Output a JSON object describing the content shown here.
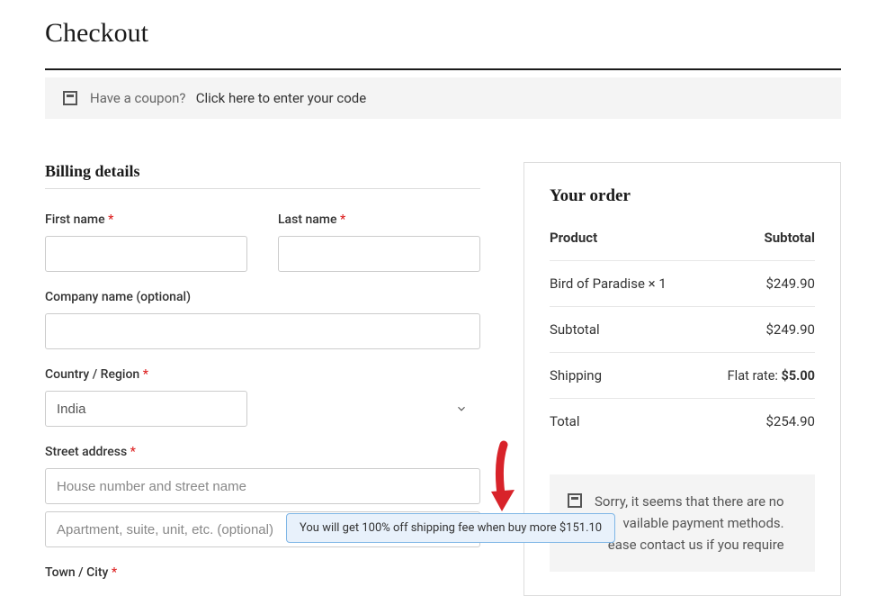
{
  "page_title": "Checkout",
  "coupon": {
    "prompt": "Have a coupon?",
    "link": "Click here to enter your code"
  },
  "billing": {
    "title": "Billing details",
    "first_name_label": "First name",
    "last_name_label": "Last name",
    "company_label": "Company name (optional)",
    "country_label": "Country / Region",
    "country_value": "India",
    "street_label": "Street address",
    "street_placeholder1": "House number and street name",
    "street_placeholder2": "Apartment, suite, unit, etc. (optional)",
    "town_label": "Town / City",
    "required": "*"
  },
  "order": {
    "title": "Your order",
    "head_product": "Product",
    "head_subtotal": "Subtotal",
    "item_name": "Bird of Paradise × 1",
    "item_price": "$249.90",
    "subtotal_label": "Subtotal",
    "subtotal_value": "$249.90",
    "shipping_label": "Shipping",
    "shipping_prefix": "Flat rate:",
    "shipping_amount": "$5.00",
    "total_label": "Total",
    "total_value": "$254.90"
  },
  "payment_notice": "Sorry, it seems that there are no available payment methods. lease contact us if you require",
  "payment_notice_line1": "Sorry, it seems that there are no",
  "payment_notice_line2": "vailable payment methods.",
  "payment_notice_line3": "ease contact us if you require",
  "promo_text": "You will get 100% off shipping fee when buy more $151.10"
}
